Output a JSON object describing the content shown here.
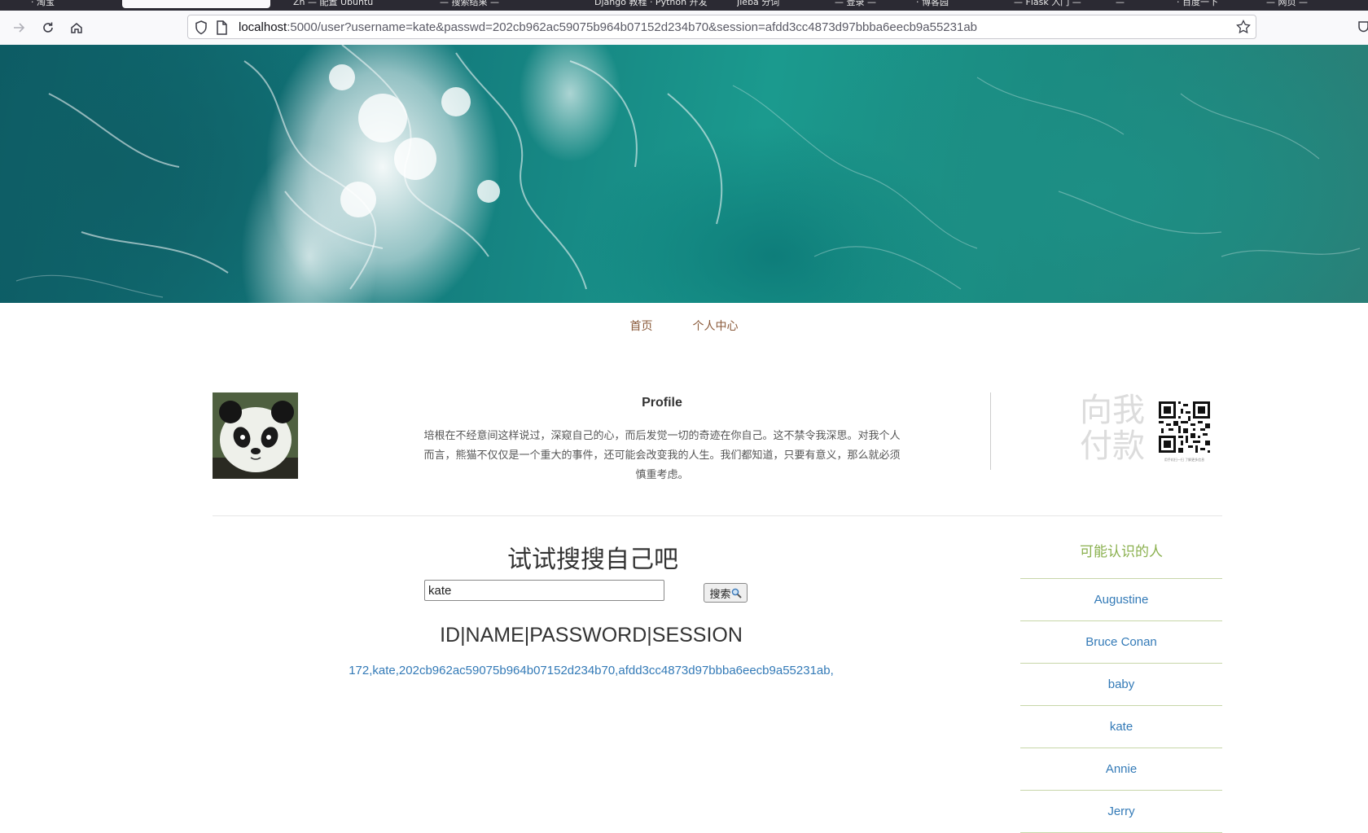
{
  "browser": {
    "tabs": [
      "· 淘宝",
      "",
      "Zh — 配置 Ubuntu",
      "— 搜索结果 —",
      "Django 教程 · Python 开发",
      "Jieba 分词",
      "— 登录 —",
      "· 博客园",
      "— Flask 入门 —",
      "—",
      "· 百度一下",
      "— 网页 —"
    ],
    "url_host": "localhost",
    "url_rest": ":5000/user?username=kate&passwd=202cb962ac59075b964b07152d234b70&session=afdd3cc4873d97bbba6eecb9a55231ab"
  },
  "nav": {
    "home": "首页",
    "personal_center": "个人中心"
  },
  "profile": {
    "title": "Profile",
    "text": "培根在不经意间这样说过，深窥自己的心，而后发觉一切的奇迹在你自己。这不禁令我深思。对我个人而言，熊猫不仅仅是一个重大的事件，还可能会改变我的人生。我们都知道，只要有意义，那么就必须慎重考虑。"
  },
  "payment": {
    "text": "向我付款",
    "qr_caption": "用手机扫一扫 了解更多信息"
  },
  "search": {
    "title": "试试搜搜自己吧",
    "value": "kate",
    "button_label": "搜索"
  },
  "results": {
    "header": "ID|NAME|PASSWORD|SESSION",
    "row": "172,kate,202cb962ac59075b964b07152d234b70,afdd3cc4873d97bbba6eecb9a55231ab,"
  },
  "sidebar": {
    "title": "可能认识的人",
    "people": [
      "Augustine",
      "Bruce Conan",
      "baby",
      "kate",
      "Annie",
      "Jerry"
    ]
  },
  "colors": {
    "nav_link": "#8a5a3a",
    "link_blue": "#337ab7",
    "sidebar_green": "#8ab04e"
  }
}
